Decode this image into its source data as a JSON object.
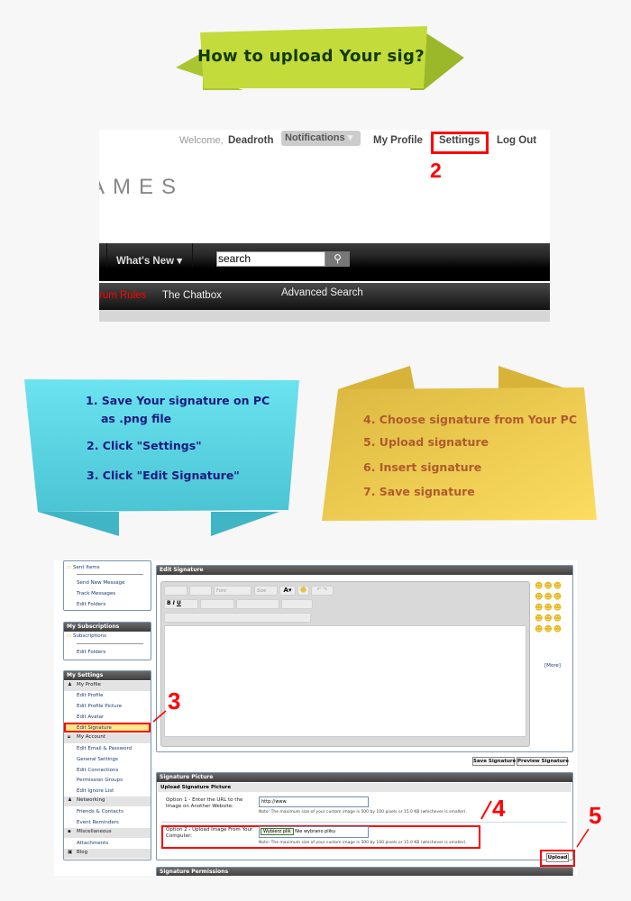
{
  "banner": {
    "title": "How to upload Your sig?",
    "color": "#c4db3c"
  },
  "forum_header": {
    "welcome": "Welcome,",
    "username": "Deadroth",
    "notifications": "Notifications",
    "my_profile": "My Profile",
    "settings": "Settings",
    "log_out": "Log Out",
    "logo_fragment": "AMES",
    "whats_new": "What's New",
    "search_value": "search",
    "forum_rules": "rum Rules",
    "chatbox": "The Chatbox",
    "advanced_search": "Advanced Search"
  },
  "markers": {
    "step2": "2",
    "step3": "3",
    "step4": "4",
    "step5": "5",
    "highlight_color": "#ff0000"
  },
  "blue_note": {
    "color": "#5fd6e6",
    "lines": [
      "1. Save Your signature on PC",
      "as .png file",
      "2. Click \"Settings\"",
      "3. Click \"Edit Signature\""
    ]
  },
  "yellow_note": {
    "color": "#f2cf55",
    "lines": [
      "4. Choose signature from Your PC",
      "5. Upload signature",
      "6. Insert signature",
      "7. Save signature"
    ]
  },
  "sidebar": {
    "messages": {
      "sent_items": "Sent Items",
      "send_new": "Send New Message",
      "track": "Track Messages",
      "edit_folders": "Edit Folders"
    },
    "subscriptions": {
      "title": "My Subscriptions",
      "subscriptions": "Subscriptions",
      "edit_folders": "Edit Folders"
    },
    "settings": {
      "title": "My Settings",
      "my_profile": "My Profile",
      "edit_profile": "Edit Profile",
      "edit_profile_picture": "Edit Profile Picture",
      "edit_avatar": "Edit Avatar",
      "edit_signature": "Edit Signature",
      "my_account": "My Account",
      "edit_email": "Edit Email & Password",
      "general_settings": "General Settings",
      "edit_connections": "Edit Connections",
      "permission_groups": "Permission Groups",
      "edit_ignore": "Edit Ignore List",
      "networking": "Networking",
      "friends": "Friends & Contacts",
      "event_reminders": "Event Reminders",
      "misc": "Miscellaneous",
      "attachments": "Attachments",
      "blog": "Blog"
    }
  },
  "editor": {
    "title": "Edit Signature",
    "font": "Font",
    "size": "Size",
    "more": "[More]",
    "save": "Save Signature",
    "preview": "Preview Signature"
  },
  "sig_picture": {
    "title": "Signature Picture",
    "subtitle": "Upload Signature Picture",
    "option1_label": "Option 1 - Enter the URL to the Image on Another Website:",
    "url_value": "http://www.",
    "note": "Note: The maximum size of your custom image is 500 by 100 pixels or 15.0 KB (whichever is smaller).",
    "option2_label": "Option 2 - Upload Image From Your Computer:",
    "choose_file": "Wybierz plik",
    "no_file": "Nie wybrano pliku",
    "upload": "Upload",
    "permissions_title": "Signature Permissions"
  }
}
